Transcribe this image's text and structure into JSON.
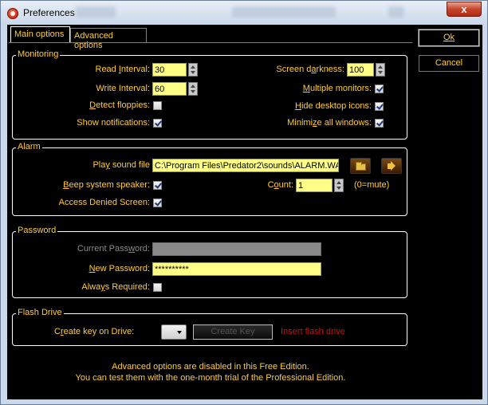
{
  "window": {
    "title": "Preferences",
    "close_label": "x"
  },
  "tabs": [
    {
      "label": "Main options",
      "active": true
    },
    {
      "label": "Advanced options",
      "active": false
    }
  ],
  "buttons": {
    "ok": "Ok",
    "cancel": "Cancel"
  },
  "monitoring": {
    "legend": "Monitoring",
    "read_interval": {
      "pre": "Read ",
      "ul": "I",
      "post": "nterval:",
      "value": "30"
    },
    "write_interval": {
      "label": "Write Interval:",
      "value": "60"
    },
    "detect_floppies": {
      "ul": "D",
      "post": "etect floppies:",
      "checked": false
    },
    "show_notifications": {
      "label": "Show notifications:",
      "checked": true
    },
    "screen_darkness": {
      "pre": "Screen d",
      "ul": "a",
      "post": "rkness:",
      "value": "100"
    },
    "multiple_monitors": {
      "ul": "M",
      "post": "ultiple monitors:",
      "checked": true
    },
    "hide_desktop_icons": {
      "ul": "H",
      "post": "ide desktop icons:",
      "checked": true
    },
    "minimize_all_windows": {
      "pre": "Minimi",
      "ul": "z",
      "post": "e all windows:",
      "checked": true
    }
  },
  "alarm": {
    "legend": "Alarm",
    "play_sound": {
      "pre": "Pla",
      "ul": "y",
      "post": " sound file",
      "value": "C:\\Program Files\\Predator2\\sounds\\ALARM.WAV"
    },
    "beep": {
      "ul": "B",
      "post": "eep system speaker:",
      "checked": true
    },
    "access_denied": {
      "label": "Access Denied Screen:",
      "checked": true
    },
    "count": {
      "pre": "C",
      "ul": "o",
      "post": "unt:",
      "value": "1",
      "hint": "(0=mute)"
    }
  },
  "password": {
    "legend": "Password",
    "current": {
      "pre": "Current Pass",
      "ul": "w",
      "post": "ord:",
      "value": ""
    },
    "new": {
      "ul": "N",
      "post": "ew Password:",
      "value": "**********"
    },
    "always_required": {
      "pre": "Alwa",
      "ul": "y",
      "post": "s Required:",
      "checked": false
    }
  },
  "flash": {
    "legend": "Flash Drive",
    "create_on": {
      "pre": "C",
      "ul": "r",
      "post": "eate key on Drive:"
    },
    "create_button": "Create Key",
    "status": "Insert flash drive",
    "status_color": "#cc1111"
  },
  "footer": {
    "line1": "Advanced options are disabled in this Free Edition.",
    "line2": "You can test them with the one-month trial of the Professional Edition."
  },
  "colors": {
    "accent": "#ffcc33",
    "field_bg": "#ffff88",
    "background": "#000000"
  }
}
